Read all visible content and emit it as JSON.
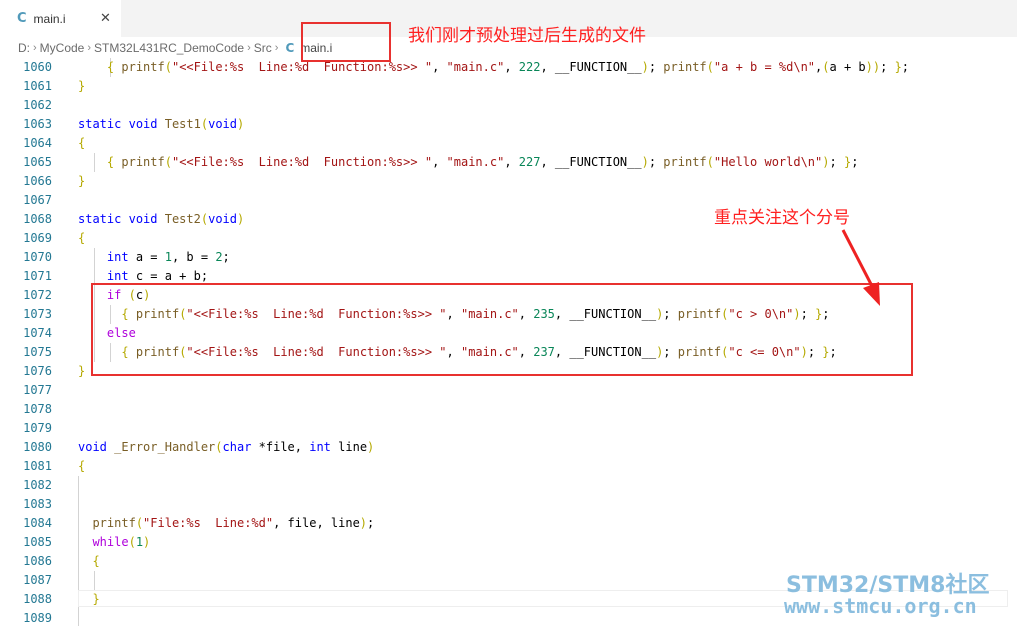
{
  "tab": {
    "icon": "C",
    "filename": "main.i",
    "close": "✕"
  },
  "breadcrumb": {
    "drive": "D:",
    "parts": [
      "MyCode",
      "STM32L431RC_DemoCode",
      "Src"
    ],
    "file_icon": "C",
    "file": "main.i"
  },
  "annotations": {
    "top": "我们刚才预处理过后生成的文件",
    "focus": "重点关注这个分号"
  },
  "watermark": {
    "line1": "STM32/STM8社区",
    "line2": "www.stmcu.org.cn"
  },
  "colors": {
    "annotation_red": "#e8312f",
    "line_number": "#237893",
    "keyword": "#0000ff",
    "string": "#a31515",
    "number": "#098658",
    "control": "#af00db"
  },
  "lines": [
    {
      "n": "1060",
      "text": "    { printf(\"<<File:%s  Line:%d  Function:%s>> \", \"main.c\", 222, __FUNCTION__); printf(\"a + b = %d\\n\",(a + b)); };"
    },
    {
      "n": "1061",
      "text": "}"
    },
    {
      "n": "1062",
      "text": ""
    },
    {
      "n": "1063",
      "text": "static void Test1(void)"
    },
    {
      "n": "1064",
      "text": "{"
    },
    {
      "n": "1065",
      "text": "    { printf(\"<<File:%s  Line:%d  Function:%s>> \", \"main.c\", 227, __FUNCTION__); printf(\"Hello world\\n\"); };"
    },
    {
      "n": "1066",
      "text": "}"
    },
    {
      "n": "1067",
      "text": ""
    },
    {
      "n": "1068",
      "text": "static void Test2(void)"
    },
    {
      "n": "1069",
      "text": "{"
    },
    {
      "n": "1070",
      "text": "    int a = 1, b = 2;"
    },
    {
      "n": "1071",
      "text": "    int c = a + b;"
    },
    {
      "n": "1072",
      "text": "    if (c)"
    },
    {
      "n": "1073",
      "text": "      { printf(\"<<File:%s  Line:%d  Function:%s>> \", \"main.c\", 235, __FUNCTION__); printf(\"c > 0\\n\"); };"
    },
    {
      "n": "1074",
      "text": "    else"
    },
    {
      "n": "1075",
      "text": "      { printf(\"<<File:%s  Line:%d  Function:%s>> \", \"main.c\", 237, __FUNCTION__); printf(\"c <= 0\\n\"); };"
    },
    {
      "n": "1076",
      "text": "}"
    },
    {
      "n": "1077",
      "text": ""
    },
    {
      "n": "1078",
      "text": ""
    },
    {
      "n": "1079",
      "text": ""
    },
    {
      "n": "1080",
      "text": "void _Error_Handler(char *file, int line)"
    },
    {
      "n": "1081",
      "text": "{"
    },
    {
      "n": "1082",
      "text": ""
    },
    {
      "n": "1083",
      "text": ""
    },
    {
      "n": "1084",
      "text": "  printf(\"File:%s  Line:%d\", file, line);"
    },
    {
      "n": "1085",
      "text": "  while(1)"
    },
    {
      "n": "1086",
      "text": "  {"
    },
    {
      "n": "1087",
      "text": ""
    },
    {
      "n": "1088",
      "text": "  }"
    },
    {
      "n": "1089",
      "text": ""
    }
  ]
}
